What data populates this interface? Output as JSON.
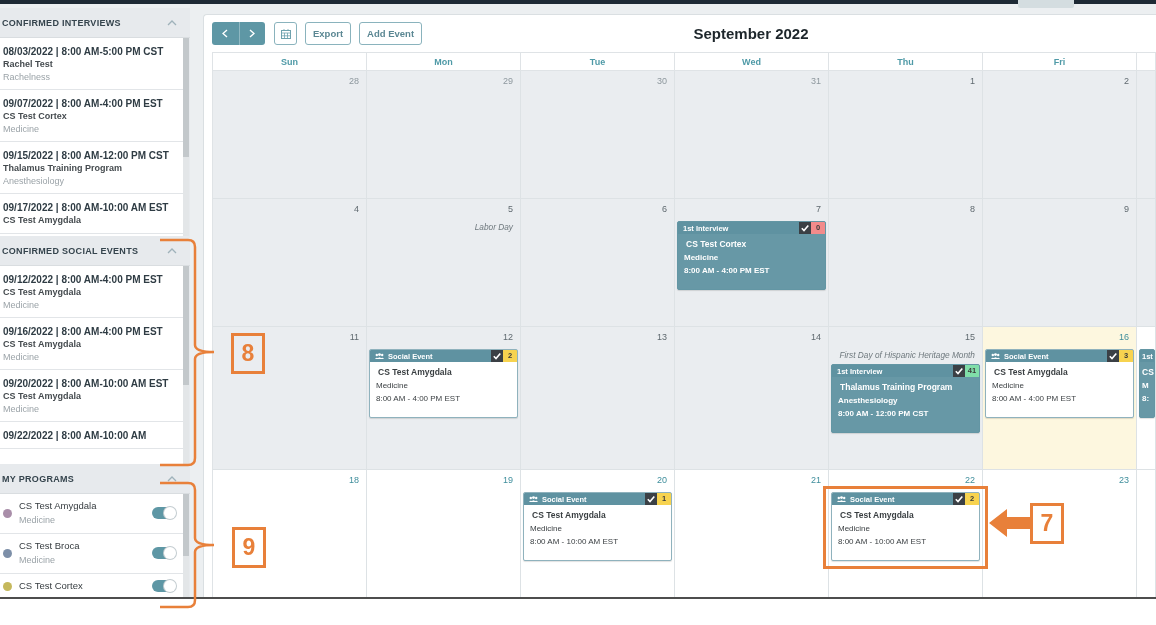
{
  "sidebar": {
    "sections": [
      {
        "title": "CONFIRMED INTERVIEWS",
        "expanded": true,
        "kind": "events",
        "items": [
          {
            "when": "08/03/2022 | 8:00 AM-5:00 PM CST",
            "name": "Rachel Test",
            "department": "Rachelness"
          },
          {
            "when": "09/07/2022 | 8:00 AM-4:00 PM EST",
            "name": "CS Test Cortex",
            "department": "Medicine"
          },
          {
            "when": "09/15/2022 | 8:00 AM-12:00 PM CST",
            "name": "Thalamus Training Program",
            "department": "Anesthesiology"
          },
          {
            "when": "09/17/2022 | 8:00 AM-10:00 AM EST",
            "name": "CS Test Amygdala"
          }
        ]
      },
      {
        "title": "CONFIRMED SOCIAL EVENTS",
        "expanded": true,
        "kind": "events",
        "items": [
          {
            "when": "09/12/2022 | 8:00 AM-4:00 PM EST",
            "name": "CS Test Amygdala",
            "department": "Medicine"
          },
          {
            "when": "09/16/2022 | 8:00 AM-4:00 PM EST",
            "name": "CS Test Amygdala",
            "department": "Medicine"
          },
          {
            "when": "09/20/2022 | 8:00 AM-10:00 AM EST",
            "name": "CS Test Amygdala",
            "department": "Medicine"
          },
          {
            "when": "09/22/2022 | 8:00 AM-10:00 AM"
          }
        ]
      },
      {
        "title": "MY PROGRAMS",
        "expanded": true,
        "kind": "programs",
        "items": [
          {
            "name": "CS Test Amygdala",
            "department": "Medicine",
            "color": "#a98ea9",
            "on": true
          },
          {
            "name": "CS Test Broca",
            "department": "Medicine",
            "color": "#7d8fa8",
            "on": true
          },
          {
            "name": "CS Test Cortex",
            "color": "#c5b85c",
            "on": true
          }
        ]
      }
    ]
  },
  "calendar": {
    "toolbar": {
      "buttons": [
        "Export",
        "Add Event"
      ]
    },
    "title": "September 2022",
    "weekdays": [
      "Sun",
      "Mon",
      "Tue",
      "Wed",
      "Thu",
      "Fri"
    ],
    "weeks": [
      {
        "days": [
          {
            "number": "28",
            "kind": "other"
          },
          {
            "number": "29",
            "kind": "other"
          },
          {
            "number": "30",
            "kind": "other"
          },
          {
            "number": "31",
            "kind": "other"
          },
          {
            "number": "1",
            "kind": "past"
          },
          {
            "number": "2",
            "kind": "past"
          },
          {
            "kind": "past"
          }
        ]
      },
      {
        "days": [
          {
            "number": "4",
            "kind": "past"
          },
          {
            "number": "5",
            "kind": "past",
            "note": "Labor Day"
          },
          {
            "number": "6",
            "kind": "past"
          },
          {
            "number": "7",
            "kind": "past",
            "events": [
              {
                "kind": "interview",
                "label": "1st Interview",
                "confirmed": true,
                "badge": {
                  "text": "0",
                  "color": "#f28b8b"
                },
                "title": "CS Test Cortex",
                "department": "Medicine",
                "time": "8:00 AM - 4:00 PM EST"
              }
            ]
          },
          {
            "number": "8",
            "kind": "past"
          },
          {
            "number": "9",
            "kind": "past"
          },
          {
            "kind": "past"
          }
        ]
      },
      {
        "days": [
          {
            "number": "11",
            "kind": "past"
          },
          {
            "number": "12",
            "kind": "past",
            "events": [
              {
                "kind": "social",
                "label": "Social Event",
                "confirmed": true,
                "badge": {
                  "text": "2",
                  "color": "#f7d34f"
                },
                "title": "CS Test Amygdala",
                "department": "Medicine",
                "time": "8:00 AM - 4:00 PM EST"
              }
            ]
          },
          {
            "number": "13",
            "kind": "past"
          },
          {
            "number": "14",
            "kind": "past"
          },
          {
            "number": "15",
            "kind": "past",
            "note": "First Day of Hispanic Heritage Month",
            "events": [
              {
                "kind": "interview",
                "label": "1st Interview",
                "confirmed": true,
                "badge": {
                  "text": "41",
                  "color": "#80dea9"
                },
                "title": "Thalamus Training Program",
                "department": "Anesthesiology",
                "time": "8:00 AM - 12:00 PM CST"
              }
            ]
          },
          {
            "number": "16",
            "kind": "today",
            "events": [
              {
                "kind": "social",
                "label": "Social Event",
                "confirmed": true,
                "badge": {
                  "text": "3",
                  "color": "#f7d34f"
                },
                "title": "CS Test Amygdala",
                "department": "Medicine",
                "time": "8:00 AM - 4:00 PM EST"
              }
            ]
          },
          {
            "kind": "future",
            "events": [
              {
                "kind": "interview",
                "label": "1st",
                "title": "CS",
                "department": "M",
                "time": "8:"
              }
            ]
          }
        ]
      },
      {
        "days": [
          {
            "number": "18",
            "kind": "future"
          },
          {
            "number": "19",
            "kind": "future"
          },
          {
            "number": "20",
            "kind": "future",
            "events": [
              {
                "kind": "social",
                "label": "Social Event",
                "confirmed": true,
                "badge": {
                  "text": "1",
                  "color": "#f7d34f"
                },
                "title": "CS Test Amygdala",
                "department": "Medicine",
                "time": "8:00 AM - 10:00 AM EST"
              }
            ]
          },
          {
            "number": "21",
            "kind": "future"
          },
          {
            "number": "22",
            "kind": "future",
            "events": [
              {
                "kind": "social",
                "label": "Social Event",
                "confirmed": true,
                "badge": {
                  "text": "2",
                  "color": "#f7d34f"
                },
                "title": "CS Test Amygdala",
                "department": "Medicine",
                "time": "8:00 AM - 10:00 AM EST"
              }
            ]
          },
          {
            "number": "23",
            "kind": "future"
          },
          {
            "kind": "future"
          }
        ]
      }
    ]
  },
  "callouts": [
    {
      "kind": "bracket",
      "label": "8"
    },
    {
      "kind": "bracket",
      "label": "9"
    },
    {
      "kind": "arrow",
      "label": "7"
    }
  ]
}
